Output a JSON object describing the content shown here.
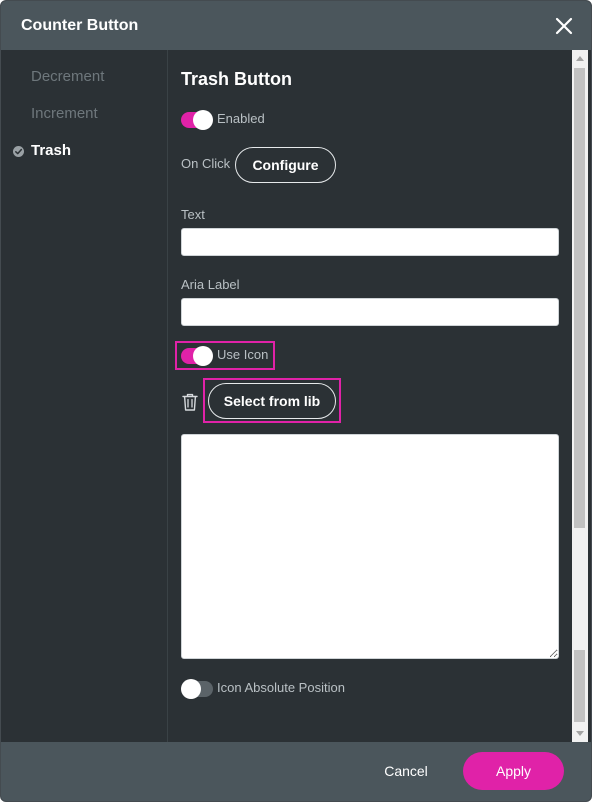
{
  "dialog": {
    "title": "Counter Button"
  },
  "sidebar": {
    "items": [
      {
        "label": "Decrement",
        "active": false
      },
      {
        "label": "Increment",
        "active": false
      },
      {
        "label": "Trash",
        "active": true
      }
    ]
  },
  "main": {
    "section_title": "Trash Button",
    "enabled_label": "Enabled",
    "enabled": true,
    "on_click_label": "On Click",
    "configure_label": "Configure",
    "text_label": "Text",
    "text_value": "",
    "aria_label_label": "Aria Label",
    "aria_label_value": "",
    "use_icon_label": "Use Icon",
    "use_icon": true,
    "select_from_lib_label": "Select from lib",
    "icon_textarea_value": "",
    "icon_absolute_label": "Icon Absolute Position",
    "icon_absolute": false
  },
  "footer": {
    "cancel_label": "Cancel",
    "apply_label": "Apply"
  },
  "colors": {
    "accent": "#e022a8",
    "panel": "#2b3135",
    "header": "#4b565c"
  },
  "icons": {
    "close": "close-icon",
    "check": "check-circle-icon",
    "trash": "trash-icon"
  }
}
